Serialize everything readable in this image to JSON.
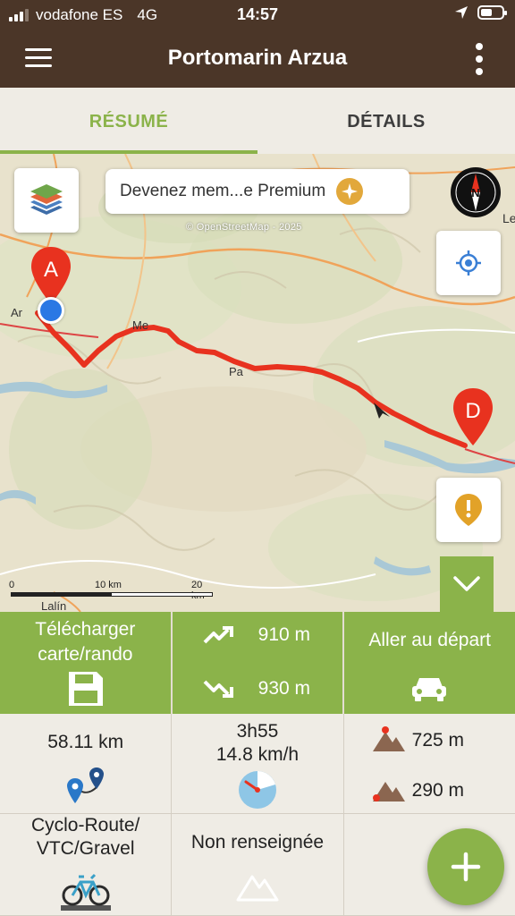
{
  "status_bar": {
    "carrier": "vodafone ES",
    "network": "4G",
    "time": "14:57"
  },
  "app_bar": {
    "title": "Portomarin Arzua"
  },
  "tabs": [
    {
      "label": "RÉSUMÉ",
      "active": true
    },
    {
      "label": "DÉTAILS",
      "active": false
    }
  ],
  "map": {
    "premium_banner": "Devenez mem...e Premium",
    "attribution": "© OpenStreetMap - 2025",
    "compass_label": "N",
    "marker_start": "A",
    "marker_end": "D",
    "scale": {
      "zero": "0",
      "mid": "10 km",
      "max": "20 km"
    },
    "place_labels": [
      "Ar",
      "Me",
      "Pa",
      "Lalín",
      "Le"
    ],
    "route_color": "#e8321f",
    "accent_color": "#8bb34a"
  },
  "actions": {
    "download_label": "Télécharger carte/rando",
    "elevation_gain": "910 m",
    "elevation_loss": "930 m",
    "go_to_start_label": "Aller au départ"
  },
  "stats": {
    "distance": "58.11 km",
    "duration": "3h55",
    "speed": "14.8 km/h",
    "max_altitude": "725 m",
    "min_altitude": "290 m",
    "activity": "Cyclo-Route/ VTC/Gravel",
    "difficulty": "Non renseignée"
  }
}
